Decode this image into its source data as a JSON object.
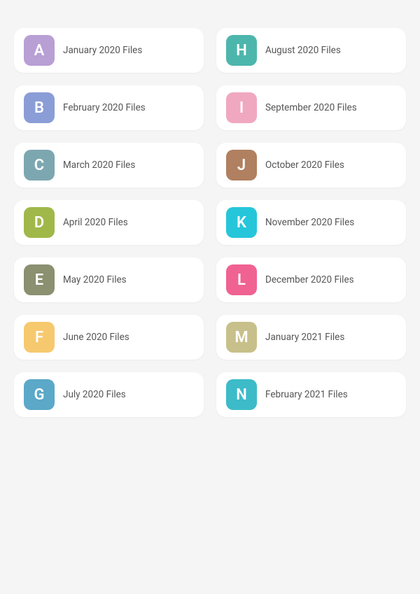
{
  "folders": [
    {
      "id": "a",
      "letter": "A",
      "label": "January 2020 Files",
      "color": "#b89fd4"
    },
    {
      "id": "h",
      "letter": "H",
      "label": "August 2020 Files",
      "color": "#4db6ac"
    },
    {
      "id": "b",
      "letter": "B",
      "label": "February 2020 Files",
      "color": "#8b9dd6"
    },
    {
      "id": "i",
      "letter": "I",
      "label": "September 2020 Files",
      "color": "#f0a8c0"
    },
    {
      "id": "c",
      "letter": "C",
      "label": "March 2020 Files",
      "color": "#7da7b0"
    },
    {
      "id": "j",
      "letter": "J",
      "label": "October 2020 Files",
      "color": "#b08060"
    },
    {
      "id": "d",
      "letter": "D",
      "label": "April 2020 Files",
      "color": "#a0b84a"
    },
    {
      "id": "k",
      "letter": "K",
      "label": "November 2020 Files",
      "color": "#26c6da"
    },
    {
      "id": "e",
      "letter": "E",
      "label": "May 2020 Files",
      "color": "#8a9070"
    },
    {
      "id": "l",
      "letter": "L",
      "label": "December 2020 Files",
      "color": "#f06292"
    },
    {
      "id": "f",
      "letter": "F",
      "label": "June 2020 Files",
      "color": "#f6c96e"
    },
    {
      "id": "m",
      "letter": "M",
      "label": "January 2021 Files",
      "color": "#c8c08a"
    },
    {
      "id": "g",
      "letter": "G",
      "label": "July 2020 Files",
      "color": "#5ba8c8"
    },
    {
      "id": "n",
      "letter": "N",
      "label": "February 2021 Files",
      "color": "#3dbbc8"
    }
  ]
}
